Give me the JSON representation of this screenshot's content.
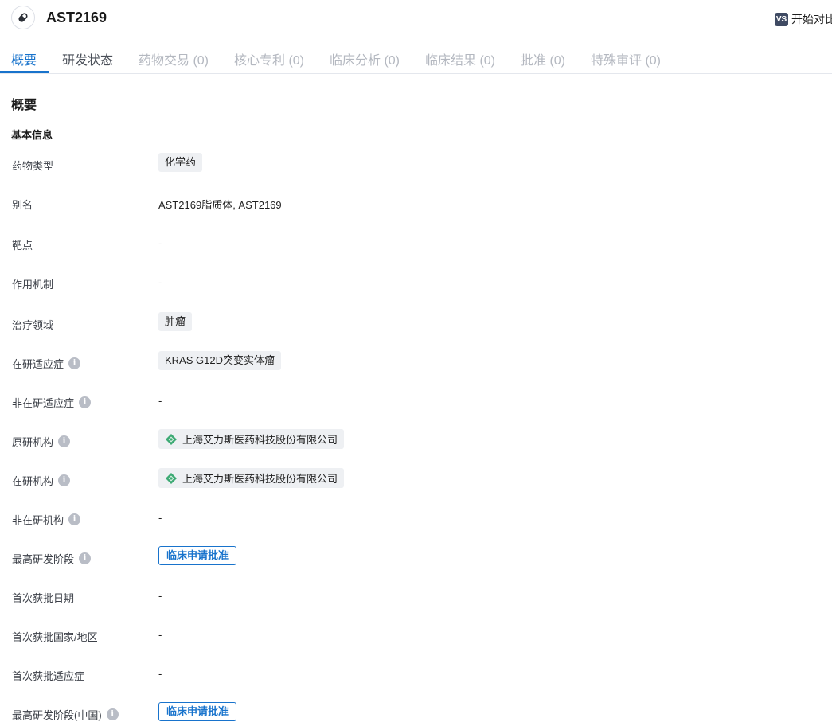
{
  "header": {
    "drug_name": "AST2169",
    "compare_badge": "VS",
    "compare_label": "开始对比"
  },
  "tabs": [
    {
      "label": "概要"
    },
    {
      "label": "研发状态"
    },
    {
      "label": "药物交易 (0)"
    },
    {
      "label": "核心专利 (0)"
    },
    {
      "label": "临床分析 (0)"
    },
    {
      "label": "临床结果 (0)"
    },
    {
      "label": "批准 (0)"
    },
    {
      "label": "特殊审评 (0)"
    }
  ],
  "overview": {
    "title": "概要",
    "basic_info_title": "基本信息",
    "rows": {
      "drug_type": {
        "label": "药物类型",
        "value": "化学药"
      },
      "alias": {
        "label": "别名",
        "value": "AST2169脂质体, AST2169"
      },
      "target": {
        "label": "靶点",
        "value": "-"
      },
      "mechanism": {
        "label": "作用机制",
        "value": "-"
      },
      "therapeutic_area": {
        "label": "治疗领域",
        "value": "肿瘤"
      },
      "active_indication": {
        "label": "在研适应症",
        "value": "KRAS G12D突变实体瘤"
      },
      "inactive_indication": {
        "label": "非在研适应症",
        "value": "-"
      },
      "originator": {
        "label": "原研机构",
        "value": "上海艾力斯医药科技股份有限公司"
      },
      "active_org": {
        "label": "在研机构",
        "value": "上海艾力斯医药科技股份有限公司"
      },
      "inactive_org": {
        "label": "非在研机构",
        "value": "-"
      },
      "highest_phase": {
        "label": "最高研发阶段",
        "value": "临床申请批准"
      },
      "first_approval_date": {
        "label": "首次获批日期",
        "value": "-"
      },
      "first_approval_country": {
        "label": "首次获批国家/地区",
        "value": "-"
      },
      "first_approval_indication": {
        "label": "首次获批适应症",
        "value": "-"
      },
      "cn_highest_phase": {
        "label": "最高研发阶段(中国)",
        "value": "临床申请批准"
      }
    },
    "info_icon": "i"
  },
  "colors": {
    "accent": "#1873cc",
    "tag_bg": "#eef0f3",
    "org_logo": "#3daa74"
  },
  "icons": {
    "drug": "pill-icon",
    "compare": "vs-icon",
    "info": "info-icon",
    "org": "company-logo-icon"
  }
}
